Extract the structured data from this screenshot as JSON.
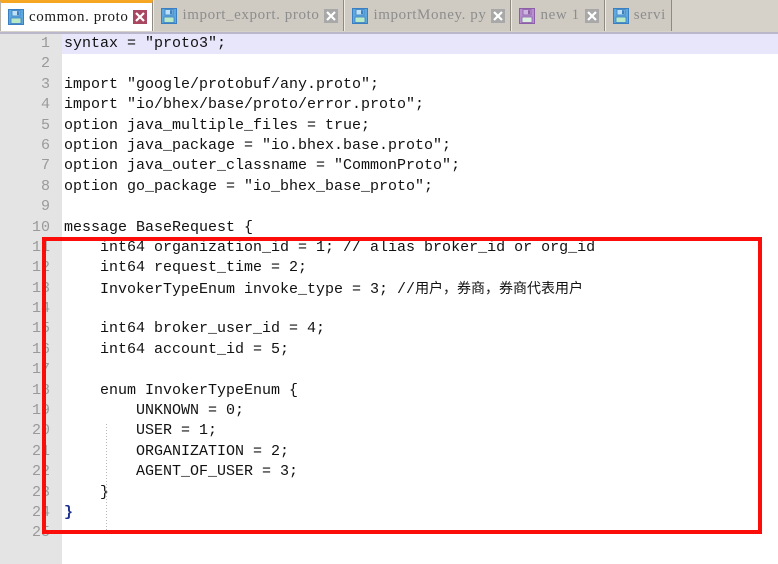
{
  "window": {
    "kind": "code-editor",
    "colors": {
      "active_tab_accent": "#f5a623",
      "tabbar_bg": "#d6d2ca",
      "inactive_tab_bg": "#cfcbc3",
      "gutter_bg": "#e4e4e4",
      "editor_bg": "#ffffff",
      "current_line_bg": "#e8e6fb",
      "caret": "#7b61c9",
      "annotation_red": "#fb0d09",
      "code_text": "#111111",
      "line_number_text": "#9a9a9a",
      "brace_highlight": "#1b2f8c"
    }
  },
  "tabs": [
    {
      "label": "common. proto",
      "icon": "floppy-save-icon-blue",
      "close_icon": "close-icon-red",
      "active": true,
      "modified": false
    },
    {
      "label": "import_export. proto",
      "icon": "floppy-save-icon-blue",
      "close_icon": "close-icon-gray",
      "active": false,
      "modified": false
    },
    {
      "label": "importMoney. py",
      "icon": "floppy-save-icon-blue",
      "close_icon": "close-icon-gray",
      "active": false,
      "modified": false
    },
    {
      "label": "new 1",
      "icon": "floppy-save-icon-purple",
      "close_icon": "close-icon-gray",
      "active": false,
      "modified": true
    },
    {
      "label": "servi",
      "icon": "floppy-save-icon-blue",
      "close_icon": "close-icon-gray",
      "active": false,
      "modified": false
    }
  ],
  "editor": {
    "language": "proto3",
    "current_line": 1,
    "line_numbers": [
      "1",
      "2",
      "3",
      "4",
      "5",
      "6",
      "7",
      "8",
      "9",
      "10",
      "11",
      "12",
      "13",
      "14",
      "15",
      "16",
      "17",
      "18",
      "19",
      "20",
      "21",
      "22",
      "23",
      "24",
      "25"
    ],
    "lines": [
      {
        "n": 1,
        "text": "syntax = \"proto3\";"
      },
      {
        "n": 2,
        "text": ""
      },
      {
        "n": 3,
        "text": "import \"google/protobuf/any.proto\";"
      },
      {
        "n": 4,
        "text": "import \"io/bhex/base/proto/error.proto\";"
      },
      {
        "n": 5,
        "text": "option java_multiple_files = true;"
      },
      {
        "n": 6,
        "text": "option java_package = \"io.bhex.base.proto\";"
      },
      {
        "n": 7,
        "text": "option java_outer_classname = \"CommonProto\";"
      },
      {
        "n": 8,
        "text": "option go_package = \"io_bhex_base_proto\";"
      },
      {
        "n": 9,
        "text": ""
      },
      {
        "n": 10,
        "text": "message BaseRequest {"
      },
      {
        "n": 11,
        "text": "    int64 organization_id = 1; // alias broker_id or org_id"
      },
      {
        "n": 12,
        "text": "    int64 request_time = 2;"
      },
      {
        "n": 13,
        "text": "    InvokerTypeEnum invoke_type = 3; //用户，券商，券商代表用户"
      },
      {
        "n": 14,
        "text": ""
      },
      {
        "n": 15,
        "text": "    int64 broker_user_id = 4;"
      },
      {
        "n": 16,
        "text": "    int64 account_id = 5;"
      },
      {
        "n": 17,
        "text": ""
      },
      {
        "n": 18,
        "text": "    enum InvokerTypeEnum {"
      },
      {
        "n": 19,
        "text": "        UNKNOWN = 0;"
      },
      {
        "n": 20,
        "text": "        USER = 1;"
      },
      {
        "n": 21,
        "text": "        ORGANIZATION = 2;"
      },
      {
        "n": 22,
        "text": "        AGENT_OF_USER = 3;"
      },
      {
        "n": 23,
        "text": "    }"
      },
      {
        "n": 24,
        "text": "}"
      },
      {
        "n": 25,
        "text": ""
      }
    ]
  },
  "annotation": {
    "shape": "rectangle",
    "color": "#fb0d09",
    "covers_lines": "9-23",
    "label": ""
  }
}
